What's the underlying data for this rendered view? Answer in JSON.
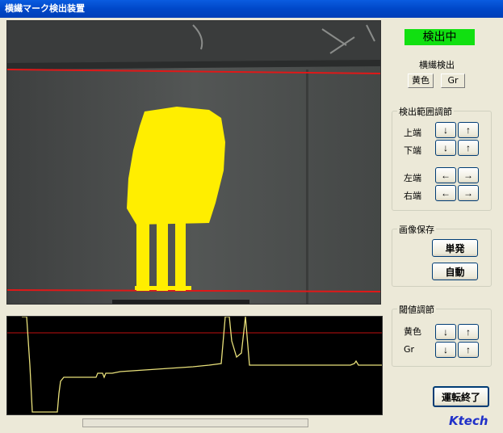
{
  "window": {
    "title": "横繊マーク検出装置"
  },
  "status": {
    "text": "検出中",
    "color": "#11e011"
  },
  "detection": {
    "title": "横繊検出",
    "modes": [
      "黄色",
      "Gr"
    ]
  },
  "range_group": {
    "title": "検出範囲調節",
    "rows": [
      {
        "label": "上端",
        "btn1": "↓",
        "btn2": "↑"
      },
      {
        "label": "下端",
        "btn1": "↓",
        "btn2": "↑"
      },
      {
        "label": "左端",
        "btn1": "←",
        "btn2": "→"
      },
      {
        "label": "右端",
        "btn1": "←",
        "btn2": "→"
      }
    ]
  },
  "save_group": {
    "title": "画像保存",
    "single": "単発",
    "auto": "自動"
  },
  "threshold_group": {
    "title": "閾値調節",
    "rows": [
      {
        "label": "黄色",
        "btn1": "↓",
        "btn2": "↑"
      },
      {
        "label": "Gr",
        "btn1": "↓",
        "btn2": "↑"
      }
    ]
  },
  "exit_button": "運転終了",
  "brand": "Ktech",
  "colors": {
    "mark": "#ffee00",
    "line": "#e01818",
    "signal": "#e8e07a",
    "title_bar": "#0a5ce0"
  }
}
